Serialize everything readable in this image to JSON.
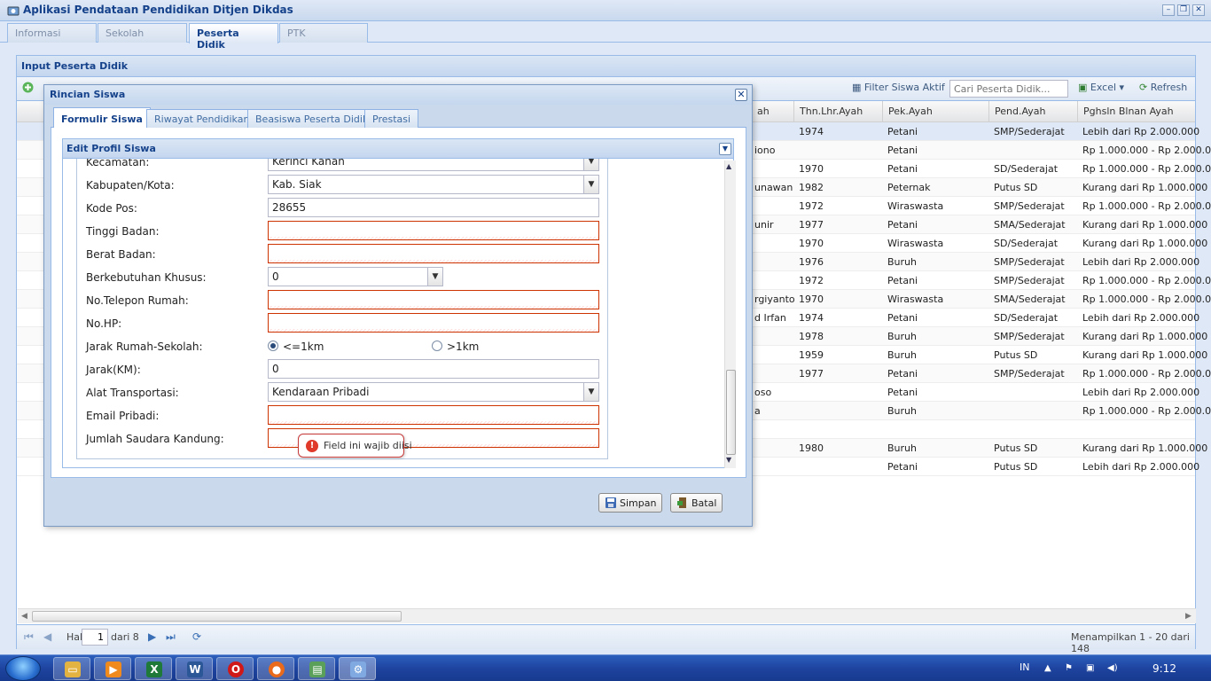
{
  "app": {
    "title": "Aplikasi Pendataan Pendidikan Ditjen Dikdas",
    "tabs": [
      "Informasi",
      "Sekolah",
      "Peserta Didik",
      "PTK"
    ],
    "active_tab": "Peserta Didik"
  },
  "panel": {
    "title": "Input Peserta Didik",
    "toolbar": {
      "filter_label": "Filter Siswa Aktif",
      "search_placeholder": "Cari Peserta Didik...",
      "excel_label": "Excel",
      "refresh_label": "Refresh"
    },
    "grid": {
      "columns": [
        "Thn.Lhr.Ayah",
        "Pek.Ayah",
        "Pend.Ayah",
        "Pghsln Blnan Ayah"
      ],
      "rows": [
        {
          "fragment": "",
          "thn": "1974",
          "pek": "Petani",
          "pend": "SMP/Sederajat",
          "pghsln": "Lebih dari Rp 2.000.000"
        },
        {
          "fragment": "iono",
          "thn": "",
          "pek": "Petani",
          "pend": "",
          "pghsln": "Rp 1.000.000 - Rp 2.000.000"
        },
        {
          "fragment": "",
          "thn": "1970",
          "pek": "Petani",
          "pend": "SD/Sederajat",
          "pghsln": "Rp 1.000.000 - Rp 2.000.000"
        },
        {
          "fragment": "unawan",
          "thn": "1982",
          "pek": "Peternak",
          "pend": "Putus SD",
          "pghsln": "Kurang dari Rp 1.000.000"
        },
        {
          "fragment": "",
          "thn": "1972",
          "pek": "Wiraswasta",
          "pend": "SMP/Sederajat",
          "pghsln": "Rp 1.000.000 - Rp 2.000.000"
        },
        {
          "fragment": "unir",
          "thn": "1977",
          "pek": "Petani",
          "pend": "SMA/Sederajat",
          "pghsln": "Kurang dari Rp 1.000.000"
        },
        {
          "fragment": "",
          "thn": "1970",
          "pek": "Wiraswasta",
          "pend": "SD/Sederajat",
          "pghsln": "Kurang dari Rp 1.000.000"
        },
        {
          "fragment": "",
          "thn": "1976",
          "pek": "Buruh",
          "pend": "SMP/Sederajat",
          "pghsln": "Lebih dari Rp 2.000.000"
        },
        {
          "fragment": "",
          "thn": "1972",
          "pek": "Petani",
          "pend": "SMP/Sederajat",
          "pghsln": "Rp 1.000.000 - Rp 2.000.000"
        },
        {
          "fragment": "rgiyanto",
          "thn": "1970",
          "pek": "Wiraswasta",
          "pend": "SMA/Sederajat",
          "pghsln": "Rp 1.000.000 - Rp 2.000.000"
        },
        {
          "fragment": "d Irfan",
          "thn": "1974",
          "pek": "Petani",
          "pend": "SD/Sederajat",
          "pghsln": "Lebih dari Rp 2.000.000"
        },
        {
          "fragment": "",
          "thn": "1978",
          "pek": "Buruh",
          "pend": "SMP/Sederajat",
          "pghsln": "Kurang dari Rp 1.000.000"
        },
        {
          "fragment": "",
          "thn": "1959",
          "pek": "Buruh",
          "pend": "Putus SD",
          "pghsln": "Kurang dari Rp 1.000.000"
        },
        {
          "fragment": "",
          "thn": "1977",
          "pek": "Petani",
          "pend": "SMP/Sederajat",
          "pghsln": "Rp 1.000.000 - Rp 2.000.000"
        },
        {
          "fragment": "oso",
          "thn": "",
          "pek": "Petani",
          "pend": "",
          "pghsln": "Lebih dari Rp 2.000.000"
        },
        {
          "fragment": "a",
          "thn": "",
          "pek": "Buruh",
          "pend": "",
          "pghsln": "Rp 1.000.000 - Rp 2.000.000"
        },
        {
          "fragment": "",
          "thn": "",
          "pek": "",
          "pend": "",
          "pghsln": ""
        },
        {
          "fragment": "",
          "thn": "1980",
          "pek": "Buruh",
          "pend": "Putus SD",
          "pghsln": "Kurang dari Rp 1.000.000"
        },
        {
          "fragment": "",
          "thn": "",
          "pek": "Petani",
          "pend": "Putus SD",
          "pghsln": "Lebih dari Rp 2.000.000"
        }
      ]
    },
    "pager": {
      "page_label": "Hal",
      "page_value": "1",
      "of_label": "dari 8",
      "summary": "Menampilkan 1 - 20 dari 148"
    }
  },
  "dialog": {
    "title": "Rincian Siswa",
    "tabs": [
      "Formulir Siswa",
      "Riwayat Pendidikan",
      "Beasiswa Peserta Didik",
      "Prestasi"
    ],
    "active_tab": "Formulir Siswa",
    "section_title": "Edit Profil Siswa",
    "fields": {
      "kecamatan": {
        "label": "Kecamatan:",
        "value": "Kerinci Kanan"
      },
      "kabupaten": {
        "label": "Kabupaten/Kota:",
        "value": "Kab. Siak"
      },
      "kode_pos": {
        "label": "Kode Pos:",
        "value": "28655"
      },
      "tinggi_badan": {
        "label": "Tinggi Badan:",
        "value": ""
      },
      "berat_badan": {
        "label": "Berat Badan:",
        "value": ""
      },
      "berkebutuhan_khusus": {
        "label": "Berkebutuhan Khusus:",
        "value": "0"
      },
      "telepon_rumah": {
        "label": "No.Telepon Rumah:",
        "value": ""
      },
      "no_hp": {
        "label": "No.HP:",
        "value": ""
      },
      "jarak_rumah": {
        "label": "Jarak Rumah-Sekolah:",
        "option_1": "<=1km",
        "option_2": ">1km",
        "selected": "<=1km"
      },
      "jarak_km": {
        "label": "Jarak(KM):",
        "value": "0"
      },
      "alat_transportasi": {
        "label": "Alat Transportasi:",
        "value": "Kendaraan Pribadi"
      },
      "email": {
        "label": "Email Pribadi:",
        "value": ""
      },
      "jumlah_saudara": {
        "label": "Jumlah Saudara Kandung:",
        "value": ""
      }
    },
    "tooltip": "Field ini wajib diisi",
    "buttons": {
      "save": "Simpan",
      "cancel": "Batal"
    }
  },
  "taskbar": {
    "language": "IN",
    "clock": "9:12"
  }
}
